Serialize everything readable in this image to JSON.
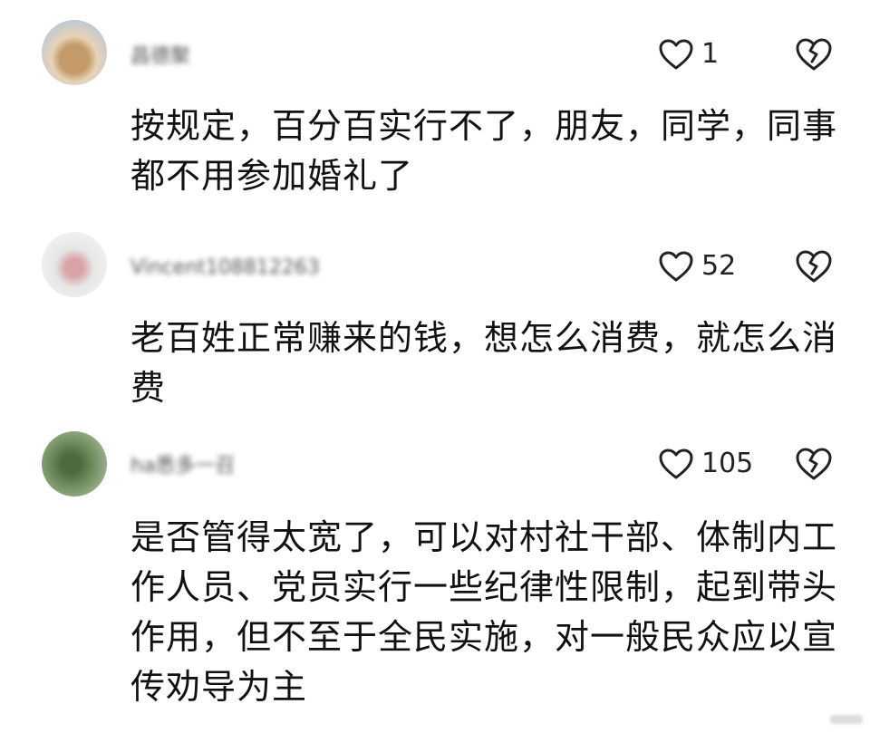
{
  "comments": [
    {
      "username": "昌德聚",
      "likes": "1",
      "text": "按规定，百分百实行不了，朋友，同学，同事都不用参加婚礼了",
      "avatar_icon": "avatar"
    },
    {
      "username": "Vincent108812263",
      "likes": "52",
      "text": "老百姓正常赚来的钱，想怎么消费，就怎么消费",
      "avatar_icon": "avatar"
    },
    {
      "username": "ha悉多一召",
      "likes": "105",
      "text": "是否管得太宽了，可以对村社干部、体制内工作人员、党员实行一些纪律性限制，起到带头作用，但不至于全民实施，对一般民众应以宣传劝导为主",
      "avatar_icon": "avatar"
    }
  ],
  "icons": {
    "like": "heart-outline-icon",
    "dislike": "broken-heart-icon"
  },
  "colors": {
    "text": "#111111",
    "icon_stroke": "#222222"
  }
}
